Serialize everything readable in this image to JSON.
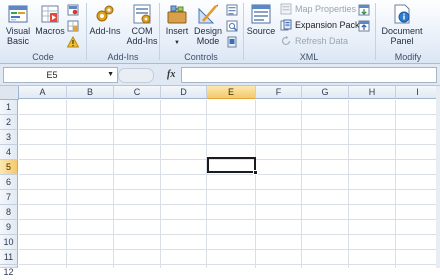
{
  "ribbon": {
    "code": {
      "label": "Code",
      "visual_basic": [
        "Visual",
        "Basic"
      ],
      "macros": "Macros"
    },
    "addins": {
      "label": "Add-Ins",
      "add_ins": "Add-Ins",
      "com_add_ins": [
        "COM",
        "Add-Ins"
      ]
    },
    "controls": {
      "label": "Controls",
      "insert": "Insert",
      "design_mode": [
        "Design",
        "Mode"
      ]
    },
    "xml": {
      "label": "XML",
      "source": "Source",
      "map_properties": "Map Properties",
      "expansion_packs": "Expansion Packs",
      "refresh_data": "Refresh Data"
    },
    "modify": {
      "label": "Modify",
      "document_panel": [
        "Document",
        "Panel"
      ]
    }
  },
  "formula_bar": {
    "name_box": "E5",
    "fx": "fx",
    "formula": ""
  },
  "sheet": {
    "columns": [
      "A",
      "B",
      "C",
      "D",
      "E",
      "F",
      "G",
      "H",
      "I"
    ],
    "rows": [
      "1",
      "2",
      "3",
      "4",
      "5",
      "6",
      "7",
      "8",
      "9",
      "10",
      "11",
      "12"
    ],
    "active_cell": "E5",
    "active_col": "E",
    "active_row": "5"
  },
  "colors": {
    "selection_header": "#f4c96b",
    "grid_line": "#dadfe6",
    "ribbon_bg": "#e6eef8"
  }
}
